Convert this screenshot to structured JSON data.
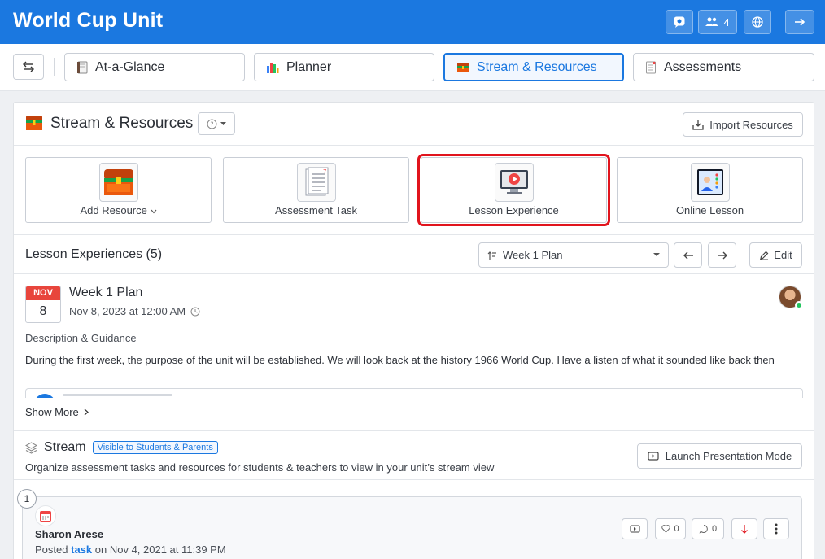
{
  "header": {
    "title": "World Cup Unit",
    "members_count": "4"
  },
  "tabs": [
    {
      "label": "At-a-Glance"
    },
    {
      "label": "Planner"
    },
    {
      "label": "Stream & Resources",
      "active": true
    },
    {
      "label": "Assessments"
    }
  ],
  "section": {
    "title": "Stream & Resources",
    "import_label": "Import Resources"
  },
  "resource_cards": [
    {
      "label": "Add Resource"
    },
    {
      "label": "Assessment Task"
    },
    {
      "label": "Lesson Experience",
      "highlighted": true
    },
    {
      "label": "Online Lesson"
    }
  ],
  "lessons": {
    "header": "Lesson Experiences (5)",
    "plan_select": "Week 1 Plan",
    "edit_label": "Edit"
  },
  "lesson": {
    "month": "NOV",
    "day": "8",
    "title": "Week 1 Plan",
    "date": "Nov 8, 2023 at 12:00 AM",
    "guidance_label": "Description & Guidance",
    "description": "During the first week, the purpose of the unit will be established. We will look back at the history 1966 World Cup. Have a listen of what it sounded like back then",
    "show_more": "Show More"
  },
  "stream": {
    "title": "Stream",
    "visibility_badge": "Visible to Students & Parents",
    "subtitle": "Organize assessment tasks and resources for students & teachers to view in your unit’s stream view",
    "launch_label": "Launch Presentation Mode"
  },
  "post": {
    "number": "1",
    "author": "Sharon Arese",
    "posted_prefix": "Posted",
    "posted_type": "task",
    "posted_suffix": "on Nov 4, 2021 at 11:39 PM",
    "likes": "0",
    "comments": "0"
  },
  "colors": {
    "brand": "#1b78e0",
    "highlight": "#e1141d",
    "calendar_red": "#e8453c"
  }
}
